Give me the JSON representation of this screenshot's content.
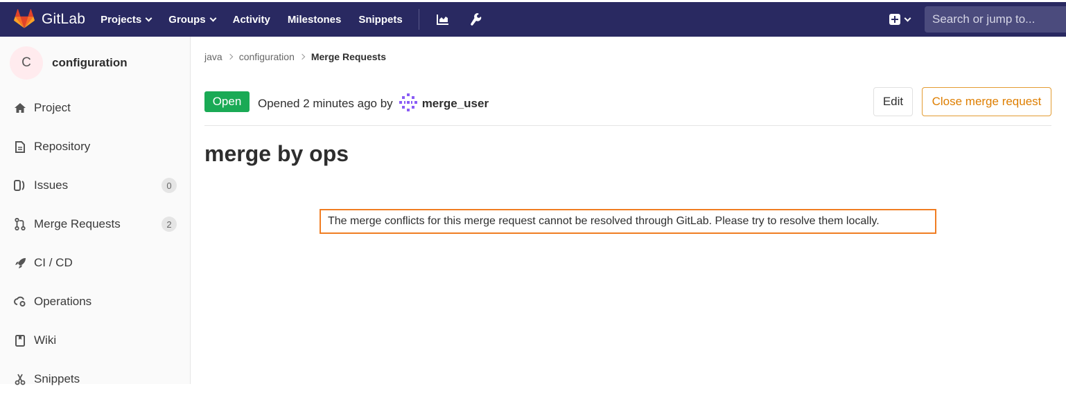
{
  "navbar": {
    "brand": "GitLab",
    "links": [
      {
        "label": "Projects",
        "dropdown": true
      },
      {
        "label": "Groups",
        "dropdown": true
      },
      {
        "label": "Activity",
        "dropdown": false
      },
      {
        "label": "Milestones",
        "dropdown": false
      },
      {
        "label": "Snippets",
        "dropdown": false
      }
    ],
    "icons": [
      "chart-icon",
      "wrench-icon"
    ],
    "search_placeholder": "Search or jump to...",
    "colors": {
      "background": "#292961",
      "search": "#4b4b7d"
    }
  },
  "sidebar": {
    "project_initial": "C",
    "project_name": "configuration",
    "items": [
      {
        "label": "Project",
        "icon": "home-icon"
      },
      {
        "label": "Repository",
        "icon": "doc-icon"
      },
      {
        "label": "Issues",
        "icon": "issues-icon",
        "badge": "0"
      },
      {
        "label": "Merge Requests",
        "icon": "merge-request-icon",
        "badge": "2"
      },
      {
        "label": "CI / CD",
        "icon": "rocket-icon"
      },
      {
        "label": "Operations",
        "icon": "cloud-gear-icon"
      },
      {
        "label": "Wiki",
        "icon": "book-icon"
      },
      {
        "label": "Snippets",
        "icon": "scissors-icon"
      }
    ]
  },
  "breadcrumb": [
    "java",
    "configuration",
    "Merge Requests"
  ],
  "merge_request": {
    "status": "Open",
    "opened_text": "Opened 2 minutes ago by",
    "author": "merge_user",
    "edit_label": "Edit",
    "close_label": "Close merge request",
    "title": "merge by ops",
    "conflict_message": "The merge conflicts for this merge request cannot be resolved through GitLab. Please try to resolve them locally.",
    "colors": {
      "open": "#1aaa55",
      "close": "#de7e00",
      "highlight": "#f07d22"
    }
  }
}
